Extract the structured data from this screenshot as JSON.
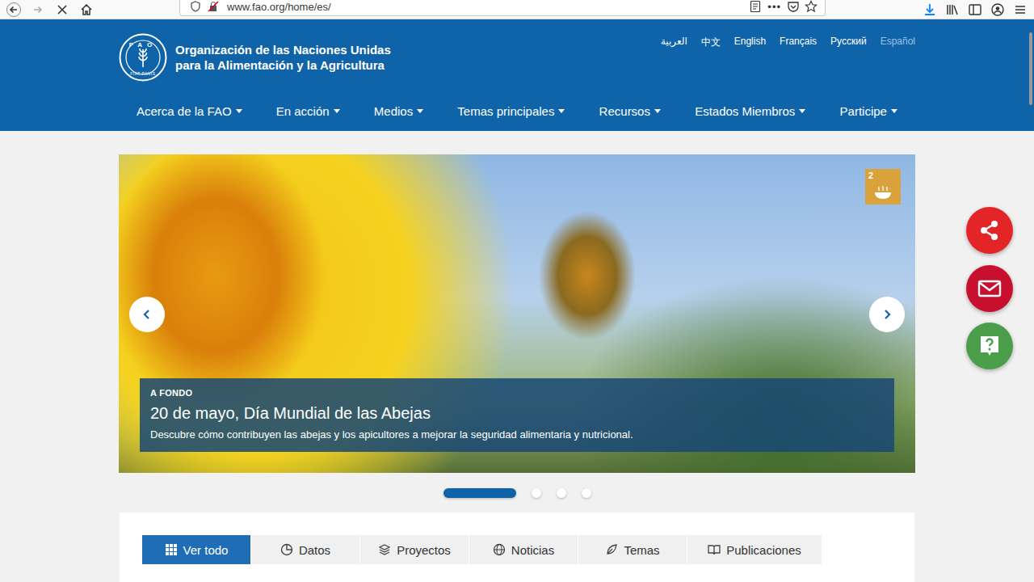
{
  "browser": {
    "url": "www.fao.org/home/es/",
    "more": "•••"
  },
  "header": {
    "logo": {
      "letters": "FAO",
      "motto": "FIAT PANIS"
    },
    "org_name": [
      "Organización de las Naciones Unidas",
      "para la Alimentación y la Agricultura"
    ],
    "languages": [
      {
        "label": "العربية",
        "selected": false
      },
      {
        "label": "中文",
        "selected": false
      },
      {
        "label": "English",
        "selected": false
      },
      {
        "label": "Français",
        "selected": false
      },
      {
        "label": "Русский",
        "selected": false
      },
      {
        "label": "Español",
        "selected": true
      }
    ],
    "nav": [
      "Acerca de la FAO",
      "En acción",
      "Medios",
      "Temas principales",
      "Recursos",
      "Estados Miembros",
      "Participe"
    ]
  },
  "carousel": {
    "sdg_badge": "2",
    "kicker": "A FONDO",
    "title": "20 de mayo, Día Mundial de las Abejas",
    "description": "Descubre cómo contribuyen las abejas y los apicultores a mejorar la seguridad alimentaria y nutricional.",
    "slides": [
      {
        "selected": true
      },
      {
        "selected": false
      },
      {
        "selected": false
      },
      {
        "selected": false
      }
    ]
  },
  "float_buttons": [
    {
      "kind": "share",
      "color": "#e42528"
    },
    {
      "kind": "mail",
      "color": "#c8102e"
    },
    {
      "kind": "help",
      "color": "#4a9e4a"
    }
  ],
  "tabs": [
    {
      "label": "Ver todo",
      "selected": true
    },
    {
      "label": "Datos",
      "selected": false
    },
    {
      "label": "Proyectos",
      "selected": false
    },
    {
      "label": "Noticias",
      "selected": false
    },
    {
      "label": "Temas",
      "selected": false
    },
    {
      "label": "Publicaciones",
      "selected": false
    }
  ]
}
